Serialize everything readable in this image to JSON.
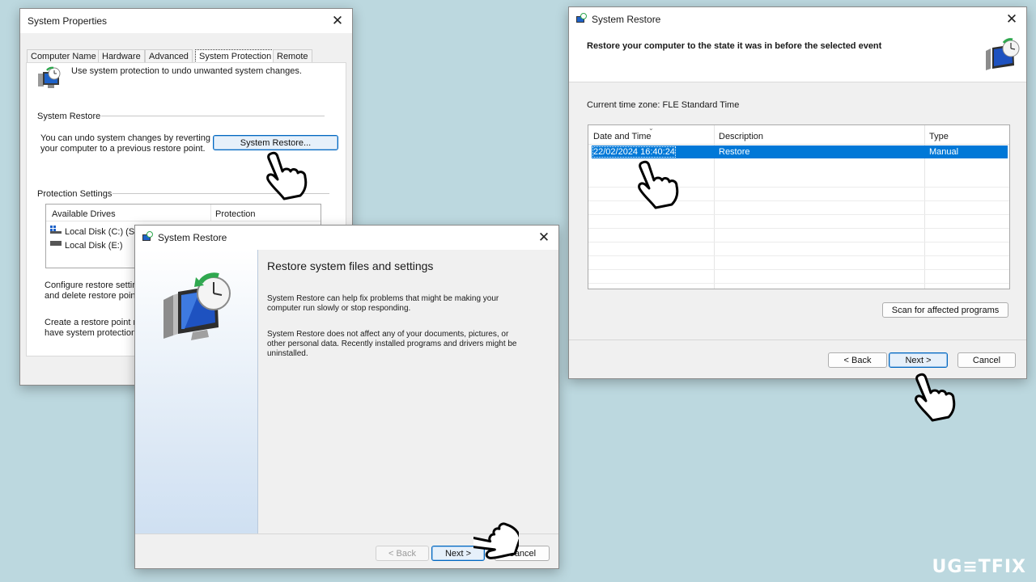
{
  "colors": {
    "accent": "#0078d7",
    "background": "#bcd8df",
    "selection": "#0078d7"
  },
  "sysprops": {
    "title": "System Properties",
    "tabs": [
      "Computer Name",
      "Hardware",
      "Advanced",
      "System Protection",
      "Remote"
    ],
    "intro": "Use system protection to undo unwanted system changes.",
    "restore_group": "System Restore",
    "restore_text_1": "You can undo system changes by reverting",
    "restore_text_2": "your computer to a previous restore point.",
    "restore_button": "System Restore...",
    "protection_group": "Protection Settings",
    "col_drives": "Available Drives",
    "col_protection": "Protection",
    "drives": [
      "Local Disk (C:) (Sy",
      "Local Disk (E:)"
    ],
    "configure_1": "Configure restore setting",
    "configure_2": "and delete restore point",
    "create_1": "Create a restore point rig",
    "create_2": "have system protection"
  },
  "wizard1": {
    "title": "System Restore",
    "heading": "Restore system files and settings",
    "p1_1": "System Restore can help fix problems that might be making your",
    "p1_2": "computer run slowly or stop responding.",
    "p2_1": "System Restore does not affect any of your documents, pictures, or",
    "p2_2": "other personal data. Recently installed programs and drivers might be",
    "p2_3": "uninstalled.",
    "back": "< Back",
    "next": "Next >",
    "cancel": "Cancel"
  },
  "wizard2": {
    "title": "System Restore",
    "header": "Restore your computer to the state it was in before the selected event",
    "timezone": "Current time zone: FLE Standard Time",
    "columns": [
      "Date and Time",
      "Description",
      "Type"
    ],
    "rows": [
      {
        "date": "22/02/2024 16:40:24",
        "description": "Restore",
        "type": "Manual"
      }
    ],
    "scan": "Scan for affected programs",
    "back": "< Back",
    "next": "Next >",
    "cancel": "Cancel"
  },
  "watermark": "UG≡TFIX"
}
